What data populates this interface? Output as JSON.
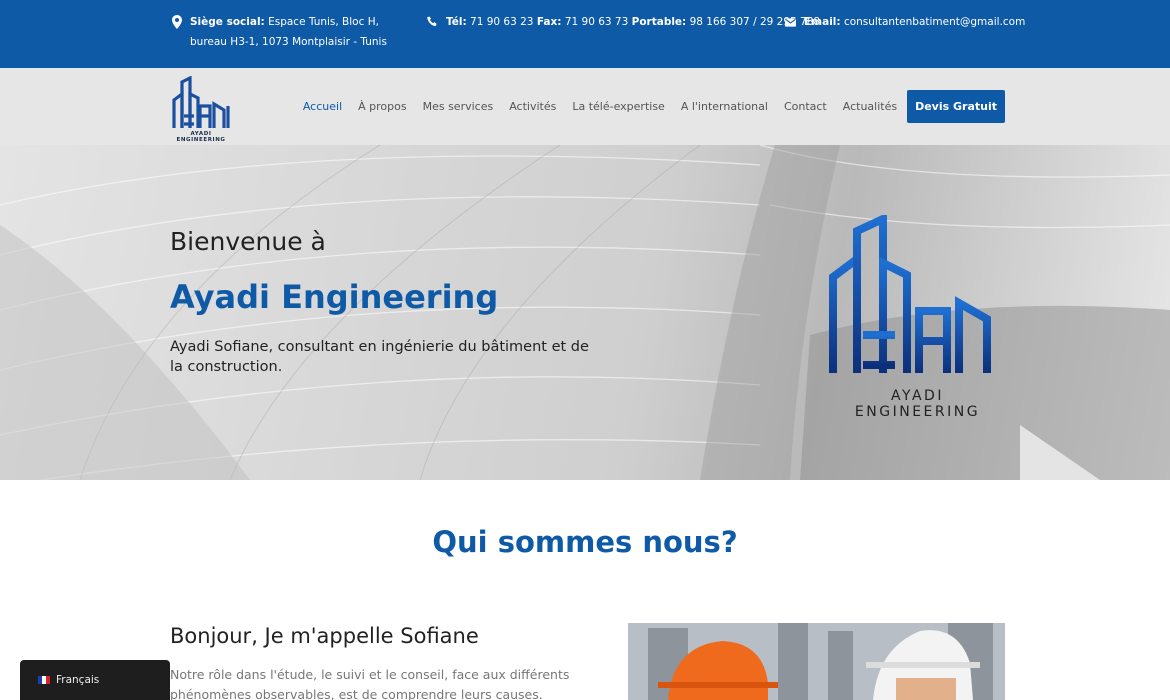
{
  "topbar": {
    "address_label": "Siège social:",
    "address_text": "Espace Tunis, Bloc H, bureau H3-1, 1073 Montplaisir - Tunis",
    "tel_label": "Tél:",
    "tel_value": "71 90 63 23",
    "fax_label": "Fax:",
    "fax_value": "71 90 63 73",
    "mobile_label": "Portable:",
    "mobile_value": "98 166 307 / 29 295 788",
    "email_label": "Email:",
    "email_value": "consultantenbatiment@gmail.com"
  },
  "logo": {
    "caption": "AYADI ENGINEERING"
  },
  "nav": {
    "items": [
      "Accueil",
      "À propos",
      "Mes services",
      "Activités",
      "La télé-expertise",
      "A l'international",
      "Contact",
      "Actualités"
    ],
    "active_index": 0,
    "cta": "Devis Gratuit"
  },
  "hero": {
    "welcome": "Bienvenue à",
    "brand": "Ayadi Engineering",
    "tagline": "Ayadi Sofiane, consultant en ingénierie du bâtiment et de la construction.",
    "logo_caption": "AYADI ENGINEERING"
  },
  "about": {
    "title": "Qui sommes nous?",
    "intro_title": "Bonjour, Je m'appelle Sofiane",
    "intro_text": "Notre rôle dans l'étude, le suivi et le conseil, face aux différents phénomènes observables, est de comprendre leurs causes."
  },
  "language": {
    "current": "Français"
  },
  "colors": {
    "primary": "#0e5aa7",
    "nav_bg": "#e6e6e6",
    "lang_bg": "#1e1e1e"
  }
}
